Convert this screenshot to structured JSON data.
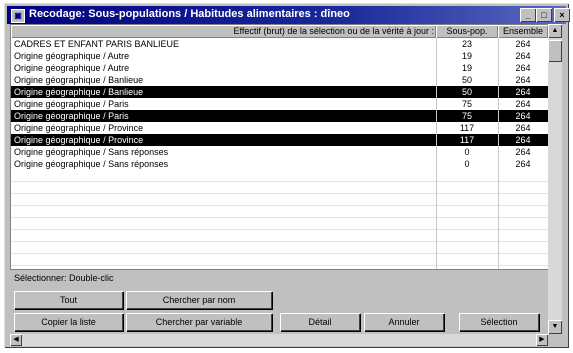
{
  "window": {
    "title": "Recodage: Sous-populations / Habitudes alimentaires : dîneo",
    "buttons": {
      "minimize": "_",
      "maximize": "□",
      "close": "×"
    }
  },
  "grid": {
    "columns": [
      "Effectif (brut) de la sélection ou de la vérité à jour :",
      "Sous-pop.",
      "Ensemble"
    ],
    "rows": [
      {
        "label": "CADRES ET ENFANT PARIS BANLIEUE",
        "sous_pop": "23",
        "ensemble": "264",
        "selected": false
      },
      {
        "label": "Origine géographique / Autre",
        "sous_pop": "19",
        "ensemble": "264",
        "selected": false
      },
      {
        "label": "Origine géographique / Autre",
        "sous_pop": "19",
        "ensemble": "264",
        "selected": false
      },
      {
        "label": "Origine géographique / Banlieue",
        "sous_pop": "50",
        "ensemble": "264",
        "selected": false
      },
      {
        "label": "Origine géographique / Banlieue",
        "sous_pop": "50",
        "ensemble": "264",
        "selected": true
      },
      {
        "label": "Origine géographique / Paris",
        "sous_pop": "75",
        "ensemble": "264",
        "selected": false
      },
      {
        "label": "Origine géographique / Paris",
        "sous_pop": "75",
        "ensemble": "264",
        "selected": true
      },
      {
        "label": "Origine géographique / Province",
        "sous_pop": "117",
        "ensemble": "264",
        "selected": false
      },
      {
        "label": "Origine géographique / Province",
        "sous_pop": "117",
        "ensemble": "264",
        "selected": true
      },
      {
        "label": "Origine géographique / Sans réponses",
        "sous_pop": "0",
        "ensemble": "264",
        "selected": false
      },
      {
        "label": "Origine géographique / Sans réponses",
        "sous_pop": "0",
        "ensemble": "264",
        "selected": false
      }
    ]
  },
  "selection_hint": "Sélectionner: Double-clic",
  "buttons": {
    "tout": "Tout",
    "chercher_nom": "Chercher par nom",
    "copier_liste": "Copier la liste",
    "chercher_variable": "Chercher par variable",
    "detail": "Détail",
    "annuler": "Annuler",
    "selection": "Sélection"
  },
  "colors": {
    "title_bar": "#000080",
    "selected_row": "#000000",
    "window": "#c0c0c0"
  }
}
